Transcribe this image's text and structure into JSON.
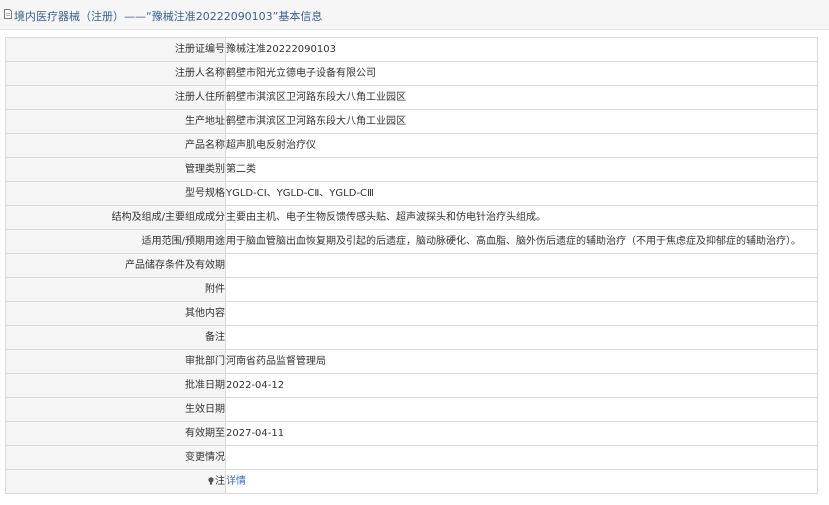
{
  "header": {
    "title": "境内医疗器械（注册）——“豫械注准20222090103”基本信息",
    "icon": "document-icon"
  },
  "rows": [
    {
      "label": "注册证编号",
      "value": "豫械注准20222090103"
    },
    {
      "label": "注册人名称",
      "value": "鹤壁市阳光立德电子设备有限公司"
    },
    {
      "label": "注册人住所",
      "value": "鹤壁市淇滨区卫河路东段大八角工业园区"
    },
    {
      "label": "生产地址",
      "value": "鹤壁市淇滨区卫河路东段大八角工业园区"
    },
    {
      "label": "产品名称",
      "value": "超声肌电反射治疗仪"
    },
    {
      "label": "管理类别",
      "value": "第二类"
    },
    {
      "label": "型号规格",
      "value": "YGLD-CⅠ、YGLD-CⅡ、YGLD-CⅢ"
    },
    {
      "label": "结构及组成/主要组成成分",
      "value": "主要由主机、电子生物反馈传感头贴、超声波探头和仿电针治疗头组成。"
    },
    {
      "label": "适用范围/预期用途",
      "value": "用于脑血管脑出血恢复期及引起的后遗症，脑动脉硬化、高血脂、脑外伤后遗症的辅助治疗（不用于焦虑症及抑郁症的辅助治疗）。"
    },
    {
      "label": "产品储存条件及有效期",
      "value": ""
    },
    {
      "label": "附件",
      "value": ""
    },
    {
      "label": "其他内容",
      "value": ""
    },
    {
      "label": "备注",
      "value": ""
    },
    {
      "label": "审批部门",
      "value": "河南省药品监督管理局"
    },
    {
      "label": "批准日期",
      "value": "2022-04-12"
    },
    {
      "label": "生效日期",
      "value": ""
    },
    {
      "label": "有效期至",
      "value": "2027-04-11"
    },
    {
      "label": "变更情况",
      "value": ""
    }
  ],
  "note_row": {
    "label": "注",
    "icon": "lightbulb-icon",
    "link_text": "详情"
  }
}
